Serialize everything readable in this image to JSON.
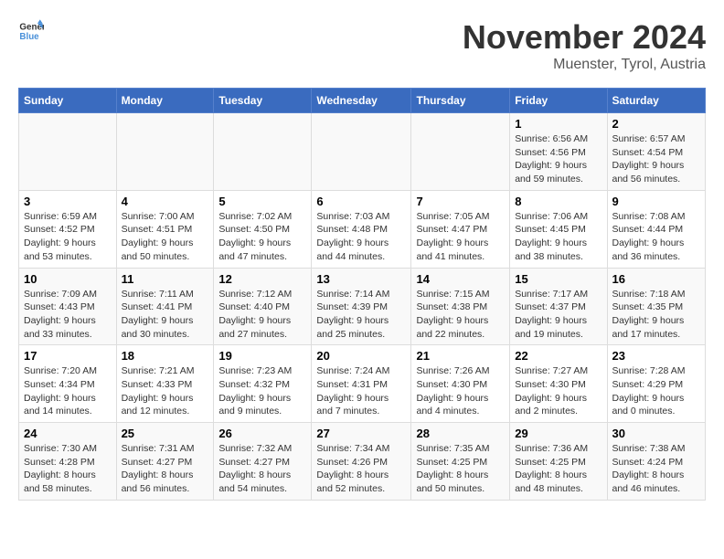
{
  "logo": {
    "line1": "General",
    "line2": "Blue"
  },
  "title": "November 2024",
  "location": "Muenster, Tyrol, Austria",
  "weekdays": [
    "Sunday",
    "Monday",
    "Tuesday",
    "Wednesday",
    "Thursday",
    "Friday",
    "Saturday"
  ],
  "weeks": [
    [
      {
        "day": "",
        "info": ""
      },
      {
        "day": "",
        "info": ""
      },
      {
        "day": "",
        "info": ""
      },
      {
        "day": "",
        "info": ""
      },
      {
        "day": "",
        "info": ""
      },
      {
        "day": "1",
        "info": "Sunrise: 6:56 AM\nSunset: 4:56 PM\nDaylight: 9 hours and 59 minutes."
      },
      {
        "day": "2",
        "info": "Sunrise: 6:57 AM\nSunset: 4:54 PM\nDaylight: 9 hours and 56 minutes."
      }
    ],
    [
      {
        "day": "3",
        "info": "Sunrise: 6:59 AM\nSunset: 4:52 PM\nDaylight: 9 hours and 53 minutes."
      },
      {
        "day": "4",
        "info": "Sunrise: 7:00 AM\nSunset: 4:51 PM\nDaylight: 9 hours and 50 minutes."
      },
      {
        "day": "5",
        "info": "Sunrise: 7:02 AM\nSunset: 4:50 PM\nDaylight: 9 hours and 47 minutes."
      },
      {
        "day": "6",
        "info": "Sunrise: 7:03 AM\nSunset: 4:48 PM\nDaylight: 9 hours and 44 minutes."
      },
      {
        "day": "7",
        "info": "Sunrise: 7:05 AM\nSunset: 4:47 PM\nDaylight: 9 hours and 41 minutes."
      },
      {
        "day": "8",
        "info": "Sunrise: 7:06 AM\nSunset: 4:45 PM\nDaylight: 9 hours and 38 minutes."
      },
      {
        "day": "9",
        "info": "Sunrise: 7:08 AM\nSunset: 4:44 PM\nDaylight: 9 hours and 36 minutes."
      }
    ],
    [
      {
        "day": "10",
        "info": "Sunrise: 7:09 AM\nSunset: 4:43 PM\nDaylight: 9 hours and 33 minutes."
      },
      {
        "day": "11",
        "info": "Sunrise: 7:11 AM\nSunset: 4:41 PM\nDaylight: 9 hours and 30 minutes."
      },
      {
        "day": "12",
        "info": "Sunrise: 7:12 AM\nSunset: 4:40 PM\nDaylight: 9 hours and 27 minutes."
      },
      {
        "day": "13",
        "info": "Sunrise: 7:14 AM\nSunset: 4:39 PM\nDaylight: 9 hours and 25 minutes."
      },
      {
        "day": "14",
        "info": "Sunrise: 7:15 AM\nSunset: 4:38 PM\nDaylight: 9 hours and 22 minutes."
      },
      {
        "day": "15",
        "info": "Sunrise: 7:17 AM\nSunset: 4:37 PM\nDaylight: 9 hours and 19 minutes."
      },
      {
        "day": "16",
        "info": "Sunrise: 7:18 AM\nSunset: 4:35 PM\nDaylight: 9 hours and 17 minutes."
      }
    ],
    [
      {
        "day": "17",
        "info": "Sunrise: 7:20 AM\nSunset: 4:34 PM\nDaylight: 9 hours and 14 minutes."
      },
      {
        "day": "18",
        "info": "Sunrise: 7:21 AM\nSunset: 4:33 PM\nDaylight: 9 hours and 12 minutes."
      },
      {
        "day": "19",
        "info": "Sunrise: 7:23 AM\nSunset: 4:32 PM\nDaylight: 9 hours and 9 minutes."
      },
      {
        "day": "20",
        "info": "Sunrise: 7:24 AM\nSunset: 4:31 PM\nDaylight: 9 hours and 7 minutes."
      },
      {
        "day": "21",
        "info": "Sunrise: 7:26 AM\nSunset: 4:30 PM\nDaylight: 9 hours and 4 minutes."
      },
      {
        "day": "22",
        "info": "Sunrise: 7:27 AM\nSunset: 4:30 PM\nDaylight: 9 hours and 2 minutes."
      },
      {
        "day": "23",
        "info": "Sunrise: 7:28 AM\nSunset: 4:29 PM\nDaylight: 9 hours and 0 minutes."
      }
    ],
    [
      {
        "day": "24",
        "info": "Sunrise: 7:30 AM\nSunset: 4:28 PM\nDaylight: 8 hours and 58 minutes."
      },
      {
        "day": "25",
        "info": "Sunrise: 7:31 AM\nSunset: 4:27 PM\nDaylight: 8 hours and 56 minutes."
      },
      {
        "day": "26",
        "info": "Sunrise: 7:32 AM\nSunset: 4:27 PM\nDaylight: 8 hours and 54 minutes."
      },
      {
        "day": "27",
        "info": "Sunrise: 7:34 AM\nSunset: 4:26 PM\nDaylight: 8 hours and 52 minutes."
      },
      {
        "day": "28",
        "info": "Sunrise: 7:35 AM\nSunset: 4:25 PM\nDaylight: 8 hours and 50 minutes."
      },
      {
        "day": "29",
        "info": "Sunrise: 7:36 AM\nSunset: 4:25 PM\nDaylight: 8 hours and 48 minutes."
      },
      {
        "day": "30",
        "info": "Sunrise: 7:38 AM\nSunset: 4:24 PM\nDaylight: 8 hours and 46 minutes."
      }
    ]
  ]
}
